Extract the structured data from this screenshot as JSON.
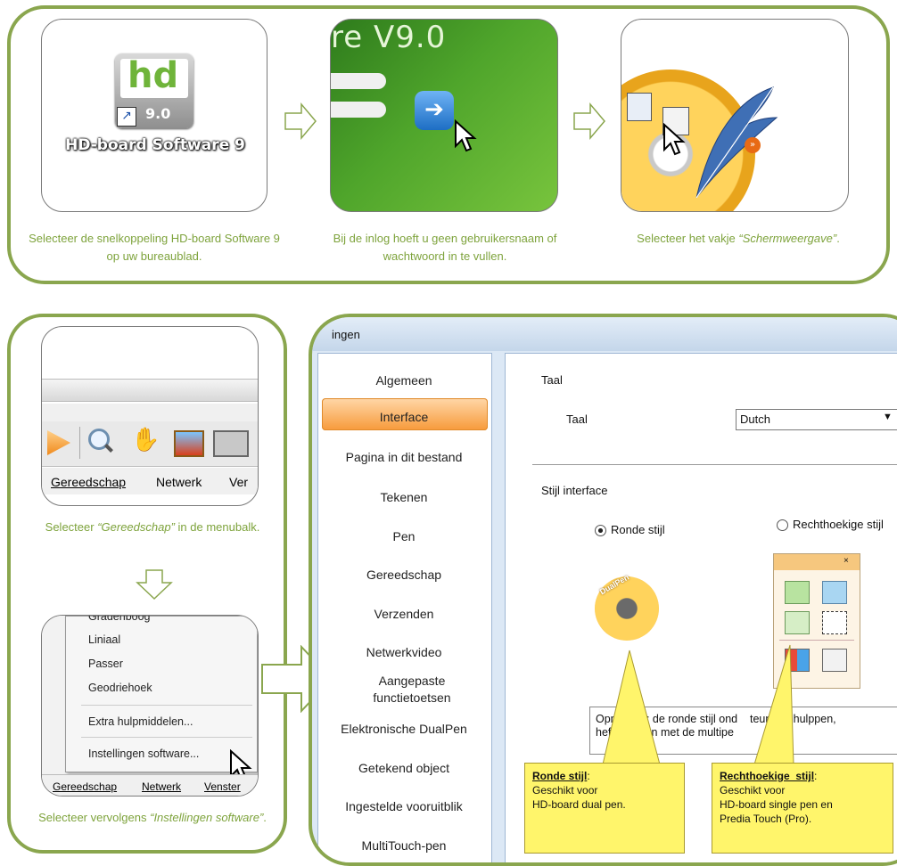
{
  "top": {
    "step1": {
      "icon_text": "hd",
      "icon_version": "9.0",
      "icon_label": "HD-board Software 9",
      "caption": "Selecteer de snelkoppeling HD-board Software 9 op uw bureaublad."
    },
    "step2": {
      "splash_text": "re V9.0",
      "caption": "Bij de inlog hoeft u geen gebruikersnaam of wachtwoord in te vullen."
    },
    "step3": {
      "caption_prefix": "Selecteer het vakje ",
      "caption_em": "“Schermweergave”",
      "caption_suffix": "."
    }
  },
  "left": {
    "menubar": [
      "Gereedschap",
      "Netwerk",
      "Ver"
    ],
    "caption1_prefix": "Selecteer ",
    "caption1_em": "“Gereedschap”",
    "caption1_suffix": " in de menubalk.",
    "dropdown": {
      "cut_item": "Gradenboog",
      "items": [
        "Liniaal",
        "Passer",
        "Geodriehoek",
        "Extra hulpmiddelen...",
        "Instellingen software..."
      ],
      "menubar": [
        "Gereedschap",
        "Netwerk",
        "Venster"
      ]
    },
    "caption2_prefix": "Selecteer vervolgens ",
    "caption2_em": "“Instellingen software”",
    "caption2_suffix": "."
  },
  "dialog": {
    "title": "ingen",
    "nav": [
      "Algemeen",
      "Interface",
      "Pagina in dit bestand",
      "Tekenen",
      "Pen",
      "Gereedschap",
      "Verzenden",
      "Netwerkvideo",
      "Aangepaste functietoetsen",
      "Elektronische DualPen",
      "Getekend object",
      "Ingestelde vooruitblik",
      "MultiTouch-pen"
    ],
    "selected_nav": "Interface",
    "group_taal": "Taal",
    "taal_label": "Taal",
    "taal_value": "Dutch",
    "group_stijl": "Stijl interface",
    "radio_round": "Ronde stijl",
    "radio_rect": "Rechthoekige stijl",
    "dualpen_text": "DualPen",
    "note_line1": "Opm  king: de ronde stijl ond    teunt de hulppen,",
    "note_line2": "heft      enen met de multipe"
  },
  "callouts": {
    "round_title": "Ronde stijl",
    "round_body": [
      "Geschikt voor",
      "HD-board dual pen."
    ],
    "rect_title": "Rechthoekige  stijl",
    "rect_body": [
      "Geschikt voor",
      "HD-board single pen en",
      "Predia Touch (Pro)."
    ]
  },
  "colors": {
    "frame_green": "#8aa64e",
    "caption_green": "#7ea33c",
    "selected_orange": "#f7a64e",
    "callout_yellow": "#fff56b"
  }
}
